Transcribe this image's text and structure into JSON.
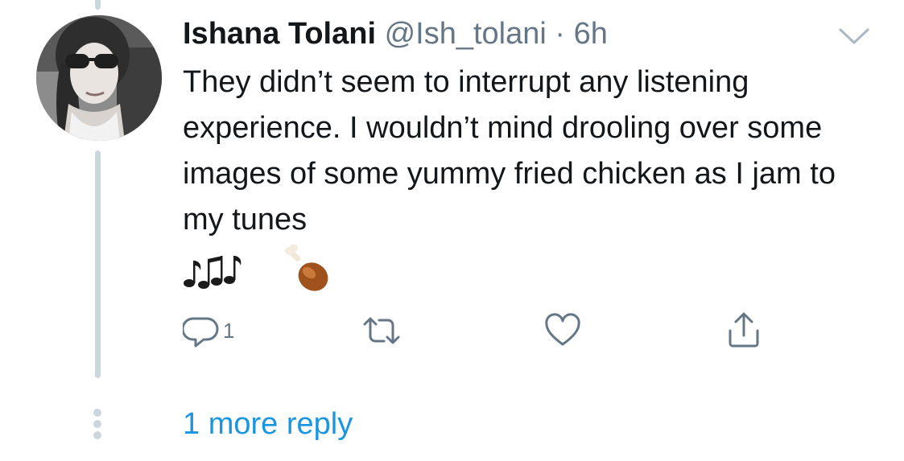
{
  "tweet": {
    "display_name": "Ishana Tolani",
    "handle": "@Ish_tolani",
    "separator": "·",
    "time": "6h",
    "text": "They didn’t seem to interrupt any listening experience. I wouldn’t mind drooling over some images of some yummy fried chicken as I jam to my tunes",
    "emoji": "🎶🍗"
  },
  "actions": {
    "reply_count": "1",
    "icons": [
      "reply-icon",
      "retweet-icon",
      "like-icon",
      "share-icon"
    ]
  },
  "thread": {
    "more_replies_label": "1 more reply"
  },
  "colors": {
    "text": "#14171a",
    "secondary": "#657786",
    "link": "#1b95e0",
    "thread_line": "#ccd6dd"
  }
}
